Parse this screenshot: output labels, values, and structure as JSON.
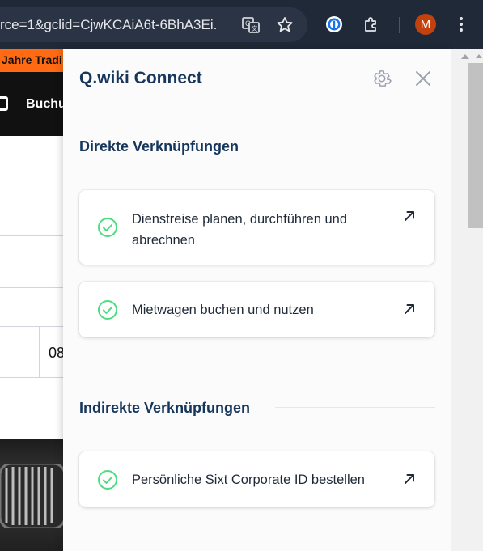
{
  "browser": {
    "url_text": "rce=1&gclid=CjwKCAiA6t-6BhA3Ei...",
    "avatar_letter": "M",
    "icons": [
      "translate-icon",
      "star-icon",
      "password-manager-icon",
      "extensions-icon",
      "kebab-menu-icon"
    ]
  },
  "background_page": {
    "promo_text": "Jahre Tradi",
    "nav_label": "Buchu",
    "table_cell": "08"
  },
  "panel": {
    "title": "Q.wiki Connect",
    "sections": [
      {
        "heading": "Direkte Verknüpfungen",
        "items": [
          {
            "label_line1": "Dienstreise planen, durchführen und",
            "label_line2": "abrechnen"
          },
          {
            "label_line1": "Mietwagen buchen und nutzen"
          }
        ]
      },
      {
        "heading": "Indirekte Verknüpfungen",
        "items": [
          {
            "label_line1": "Persönliche Sixt Corporate ID bestellen"
          }
        ]
      }
    ]
  },
  "colors": {
    "title": "#16365c",
    "check": "#4ade80",
    "promo": "#ff6a13",
    "toolbar": "#1f2937"
  }
}
